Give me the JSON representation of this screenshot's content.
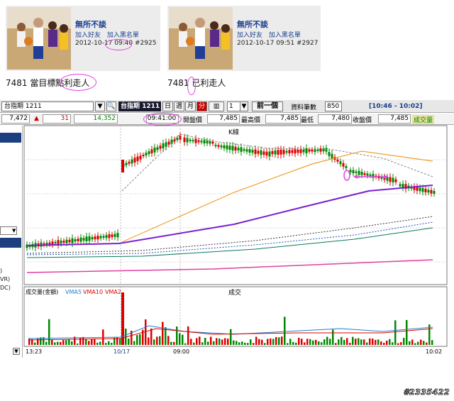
{
  "posts": [
    {
      "user": "無所不談",
      "links": [
        "加入好友",
        "加入黑名單"
      ],
      "date": "2012-10-17",
      "time": "09:40",
      "id": "#2925",
      "body_prefix": "7481 當目標點",
      "body_mark": "利走人"
    },
    {
      "user": "無所不談",
      "links": [
        "加入好友",
        "加入黑名單"
      ],
      "date": "2012-10-17",
      "time": "09:51",
      "id": "#2927",
      "body_prefix": "7481 ",
      "body_mark": "已",
      "body_suffix": "利走人"
    }
  ],
  "toolbar": {
    "code": "台指期 1211",
    "name": "台指期 1211",
    "periods": [
      "日",
      "週",
      "月",
      "分"
    ],
    "active_period": "分",
    "interval": "1",
    "prev_label": "前一個",
    "data_count_label": "資料筆數",
    "data_count": "850",
    "time_range": "[10:46 - 10:02]"
  },
  "quote": {
    "last": "7,472",
    "change_symbol": "▲",
    "change": "31",
    "volume": "14,352",
    "time": "09:41:00",
    "open_label": "開盤價",
    "open": "7,485",
    "high_label": "最高價",
    "high": "7,485",
    "low_label": "最低",
    "low": "7,480",
    "close_label": "收盤價",
    "close": "7,485",
    "vol_label": "成交量"
  },
  "left_panel": {
    "rows": [
      ")",
      "VR)",
      "DC)"
    ]
  },
  "chart": {
    "main_title": "K線",
    "vol_title": "成交",
    "vol_legend": {
      "label": "成交量(金額)",
      "vma5": "VMA5",
      "vma10": "VMA10",
      "vma20": "VMA2"
    },
    "xticks": [
      "13:23",
      "10/17",
      "09:00",
      "10:02"
    ],
    "colors": {
      "up": "#dd0000",
      "down": "#008800",
      "ma_short": "#f0a030",
      "ma_long": "#7a1fd0",
      "ma_pink": "#e040a0",
      "marker": "#e040e0"
    }
  },
  "chart_data": {
    "type": "candlestick",
    "title": "K線",
    "xlabel": "",
    "ylabel": "",
    "series": [
      {
        "name": "VMA5",
        "values": []
      },
      {
        "name": "VMA10",
        "values": []
      },
      {
        "name": "VMA2",
        "values": []
      }
    ],
    "x_ticks": [
      "13:23",
      "10/17",
      "09:00",
      "10:02"
    ],
    "grid": true
  },
  "watermark": "#2335422"
}
